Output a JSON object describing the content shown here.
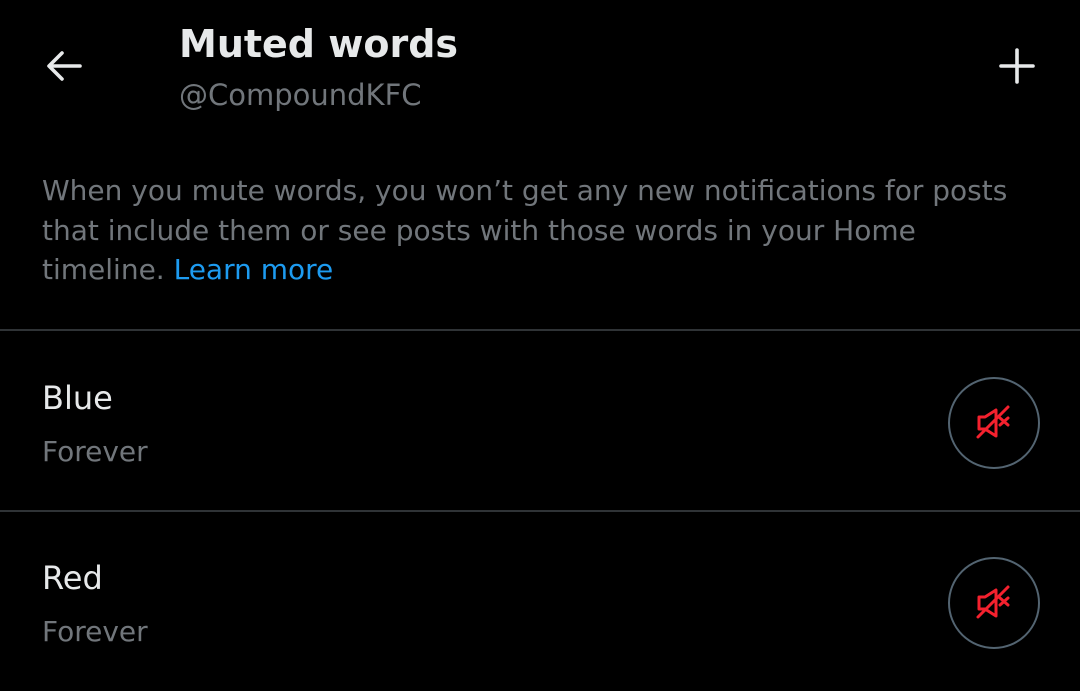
{
  "header": {
    "title": "Muted words",
    "handle": "@CompoundKFC",
    "back_icon": "arrow-left-icon",
    "add_icon": "plus-icon"
  },
  "description": {
    "text": "When you mute words, you won’t get any new notifications for posts that include them or see posts with those words in your Home timeline. ",
    "link_text": "Learn more"
  },
  "muted_words": [
    {
      "word": "Blue",
      "duration": "Forever",
      "action_icon": "speaker-muted-icon"
    },
    {
      "word": "Red",
      "duration": "Forever",
      "action_icon": "speaker-muted-icon"
    }
  ],
  "colors": {
    "background": "#000000",
    "primary_text": "#e7e9ea",
    "secondary_text": "#71767b",
    "link": "#1d9bf0",
    "divider": "#2f3336",
    "mute_icon": "#f4212e"
  }
}
